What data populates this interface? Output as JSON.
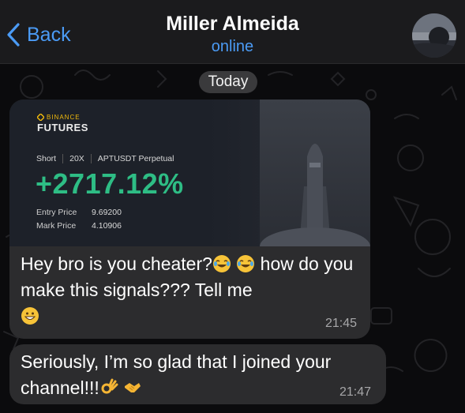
{
  "header": {
    "back_label": "Back",
    "contact_name": "Miller Almeida",
    "contact_status": "online"
  },
  "chat": {
    "date_divider": "Today",
    "messages": [
      {
        "image_card": {
          "brand_top": "BINANCE",
          "brand_bottom": "FUTURES",
          "side": "Short",
          "leverage": "20X",
          "symbol": "APTUSDT Perpetual",
          "pnl": "+2717.12%",
          "entry_label": "Entry Price",
          "entry_value": "9.69200",
          "mark_label": "Mark Price",
          "mark_value": "4.10906"
        },
        "text_part1": "Hey bro is you cheater?",
        "text_part2": " how do you make this signals??? Tell me",
        "time": "21:45"
      },
      {
        "text": "Seriously, I’m so glad that I joined your channel!!!",
        "time": "21:47"
      }
    ]
  },
  "icons": {
    "back": "chevron-left-icon",
    "emojis": [
      "face-with-tears-of-joy",
      "face-with-tears-of-joy",
      "grinning-face",
      "ok-hand",
      "handshake"
    ]
  },
  "colors": {
    "accent_blue": "#4b9bf5",
    "bubble": "#2c2c2e",
    "pnl_green": "#2ebd85",
    "binance_yellow": "#f0b90b"
  }
}
